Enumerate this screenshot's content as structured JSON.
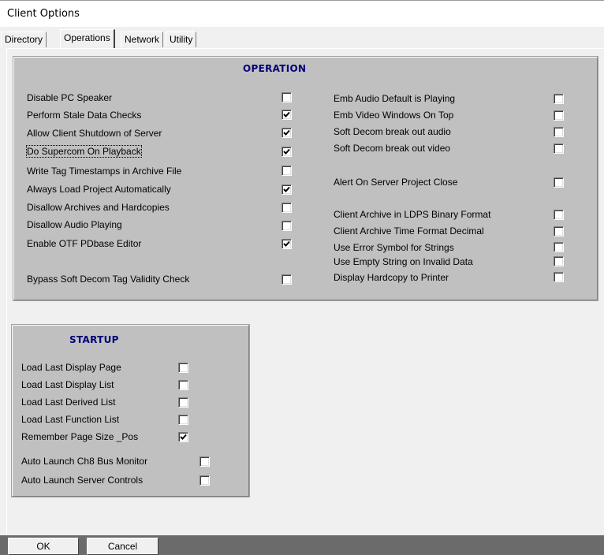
{
  "window": {
    "title": "Client Options"
  },
  "tabs": [
    {
      "label": "Directory",
      "active": false
    },
    {
      "label": "Operations",
      "active": true
    },
    {
      "label": "Network",
      "active": false
    },
    {
      "label": "Utility",
      "active": false
    }
  ],
  "operation": {
    "title": "OPERATION",
    "left_options": [
      {
        "label": "Disable PC Speaker",
        "checked": false
      },
      {
        "label": "Perform Stale Data Checks",
        "checked": true
      },
      {
        "label": "Allow Client Shutdown of Server",
        "checked": true
      },
      {
        "label": "Do Supercom On Playback",
        "checked": true,
        "focused": true
      },
      {
        "label": "Write Tag Timestamps in Archive File",
        "checked": false
      },
      {
        "label": "Always Load Project Automatically",
        "checked": true
      },
      {
        "label": "Disallow Archives and Hardcopies",
        "checked": false
      },
      {
        "label": "Disallow Audio Playing",
        "checked": false
      },
      {
        "label": "Enable OTF PDbase Editor",
        "checked": true
      },
      {
        "label": "Bypass Soft Decom Tag Validity Check",
        "checked": false
      }
    ],
    "right_options": [
      {
        "label": "Emb Audio  Default is Playing",
        "checked": false
      },
      {
        "label": "Emb Video Windows On Top",
        "checked": false
      },
      {
        "label": "Soft Decom break out audio",
        "checked": false
      },
      {
        "label": "Soft Decom break out video",
        "checked": false
      },
      {
        "label": "Alert On Server Project Close",
        "checked": false
      },
      {
        "label": "Client Archive in LDPS Binary Format",
        "checked": false
      },
      {
        "label": "Client Archive Time Format Decimal",
        "checked": false
      },
      {
        "label": "Use Error Symbol for Strings",
        "checked": false
      },
      {
        "label": "Use Empty String on Invalid Data",
        "checked": false
      },
      {
        "label": "Display Hardcopy to Printer",
        "checked": false
      }
    ]
  },
  "startup": {
    "title": "STARTUP",
    "options": [
      {
        "label": "Load Last Display Page",
        "checked": false
      },
      {
        "label": "Load Last Display List",
        "checked": false
      },
      {
        "label": "Load Last Derived List",
        "checked": false
      },
      {
        "label": "Load Last Function List",
        "checked": false
      },
      {
        "label": "Remember Page Size _Pos",
        "checked": true
      },
      {
        "label": "Auto Launch Ch8 Bus Monitor",
        "checked": false
      },
      {
        "label": "Auto Launch Server Controls",
        "checked": false
      }
    ]
  },
  "buttons": {
    "ok": "OK",
    "cancel": "Cancel"
  },
  "colors": {
    "panel": "#c0c0c0",
    "group_title": "#00007a",
    "bottom_bar": "#6b6b6b",
    "window_bg": "#f0f0f0"
  },
  "icons": {
    "checked": "checkmark-icon"
  }
}
